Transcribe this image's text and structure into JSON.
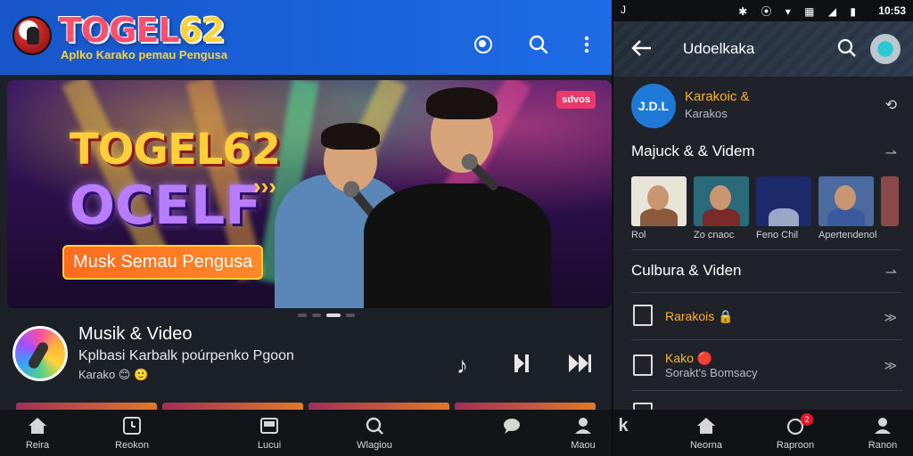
{
  "left": {
    "brand": {
      "title_main": "TOGEL",
      "title_num": "62",
      "subtitle": "Aplko Karako pemau Pengusa"
    },
    "toolbar": {
      "icons": [
        "cast-icon",
        "search-icon",
        "more-vert-icon"
      ]
    },
    "banner": {
      "headline": "TOGEL62",
      "headline2": "OCELF",
      "arrows": "›››",
      "pill": "Musk Semau Pengusa",
      "tag": "sdvos"
    },
    "now_playing": {
      "title": "Musik & Video",
      "subtitle": "Kplbasi Karbalk poúrpenko Pgoon",
      "meta": "Karako 😊 🙂"
    },
    "bottom_nav": [
      {
        "label": "Reira",
        "icon": "home-icon"
      },
      {
        "label": "Reokon",
        "icon": "history-icon"
      },
      {
        "label": "Lucui",
        "icon": "library-icon"
      },
      {
        "label": "Wlagiou",
        "icon": "explore-icon"
      },
      {
        "label": "",
        "icon": "chat-icon"
      },
      {
        "label": "Maou",
        "icon": "profile-icon"
      }
    ],
    "colors": {
      "topbar": "#1a63dc",
      "brand_pink": "#ff4f6e",
      "brand_yellow": "#ffd23a"
    }
  },
  "right": {
    "status": {
      "left": "J",
      "icons": "✱ ⦿ ▾ ▦ ◢ ▮",
      "time": "10:53"
    },
    "header": {
      "title": "Udoelkaka"
    },
    "profile": {
      "badge": "J.D.L",
      "name": "Karakoic &",
      "sub": "Karakos"
    },
    "section1": {
      "title": "Majuck & & Videm",
      "arrow": "⇀"
    },
    "thumbs": [
      {
        "label": "Rol"
      },
      {
        "label": "Zo cnaoc"
      },
      {
        "label": "Feno Chil"
      },
      {
        "label": "Apertendenol"
      },
      {
        "label": ""
      }
    ],
    "section2": {
      "title": "Culbura & Viden",
      "arrow": "⇀"
    },
    "list": [
      {
        "title": "Rarakois 🔒",
        "sub": "",
        "arrow": "≫"
      },
      {
        "title": "Kako 🔴",
        "sub": "Sorakt's Bomsacy",
        "arrow": "≫"
      }
    ],
    "bottom_nav": [
      {
        "label": "",
        "icon": "k-icon"
      },
      {
        "label": "Neorna",
        "icon": "home-icon"
      },
      {
        "label": "Raproon",
        "icon": "alerts-icon",
        "badge": "2"
      },
      {
        "label": "Ranon",
        "icon": "profile-icon"
      }
    ],
    "colors": {
      "accent_orange": "#ffb12a",
      "badge_blue": "#1e7ad6"
    }
  }
}
